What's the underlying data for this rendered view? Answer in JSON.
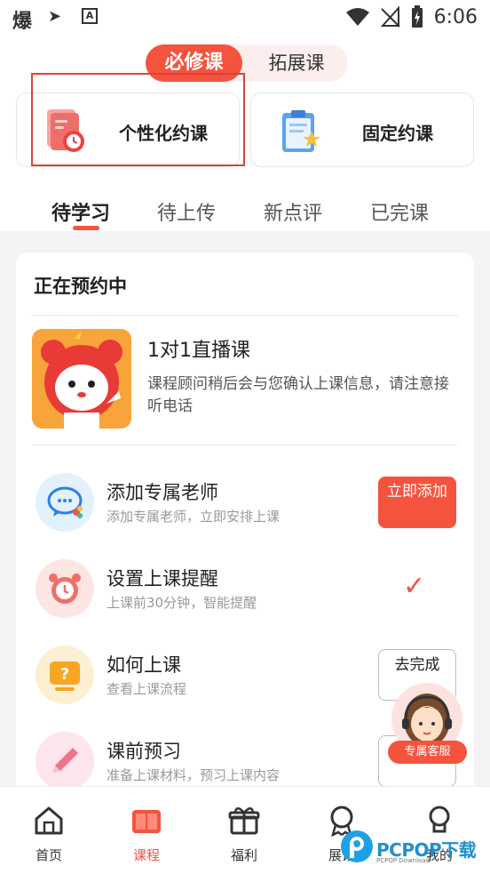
{
  "status_bar": {
    "app_glyph": "爆",
    "time": "6:06"
  },
  "course_toggle": {
    "active": "必修课",
    "inactive": "拓展课"
  },
  "booking": {
    "personal_label": "个性化约课",
    "fixed_label": "固定约课"
  },
  "tabs": [
    {
      "label": "待学习",
      "active": true
    },
    {
      "label": "待上传",
      "active": false
    },
    {
      "label": "新点评",
      "active": false
    },
    {
      "label": "已完课",
      "active": false
    }
  ],
  "panel": {
    "title": "正在预约中",
    "course": {
      "title": "1对1直播课",
      "desc": "课程顾问稍后会与您确认上课信息，请注意接听电话"
    },
    "steps": [
      {
        "title": "添加专属老师",
        "sub": "添加专属老师，立即安排上课",
        "action": "立即添加",
        "icon": "wechat-icon"
      },
      {
        "title": "设置上课提醒",
        "sub": "上课前30分钟，智能提醒",
        "action": "done",
        "icon": "alarm-clock-icon"
      },
      {
        "title": "如何上课",
        "sub": "查看上课流程",
        "action": "去完成",
        "icon": "question-monitor-icon"
      },
      {
        "title": "课前预习",
        "sub": "准备上课材料，预习上课内容",
        "action": "去完成",
        "icon": "pencil-icon"
      }
    ]
  },
  "service_float": {
    "label": "专属客服"
  },
  "bottom_nav": [
    {
      "label": "首页",
      "icon": "home-icon",
      "active": false
    },
    {
      "label": "课程",
      "icon": "book-icon",
      "active": true
    },
    {
      "label": "福利",
      "icon": "gift-icon",
      "active": false
    },
    {
      "label": "展馆",
      "icon": "medal-icon",
      "active": false
    },
    {
      "label": "我的",
      "icon": "profile-icon",
      "active": false
    }
  ],
  "watermark": {
    "text": "PCPOP下载",
    "sub": "PCPOP Download"
  },
  "colors": {
    "accent": "#f5533d",
    "pink_bg": "#fdeeee"
  }
}
